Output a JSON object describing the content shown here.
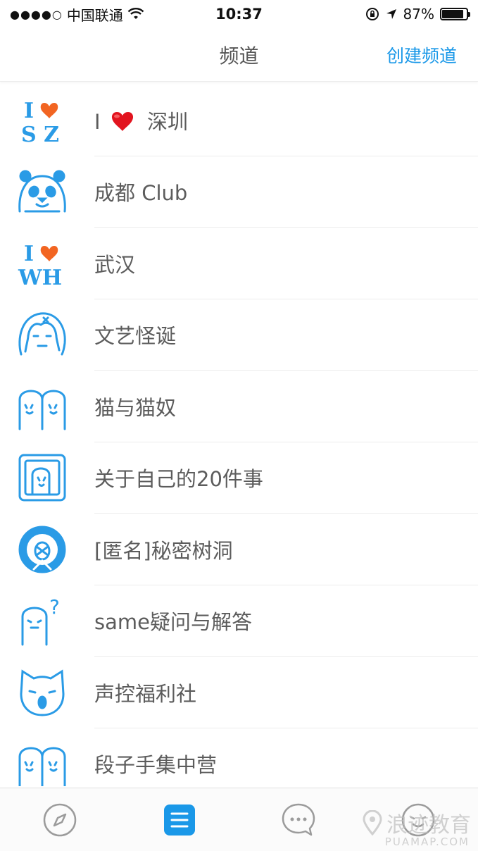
{
  "status_bar": {
    "signal": "●●●●○",
    "carrier": "中国联通",
    "time": "10:37",
    "battery_percent": "87%",
    "battery_level": 0.87
  },
  "nav": {
    "title": "频道",
    "create_label": "创建频道"
  },
  "channels": [
    {
      "label_prefix": "I",
      "label": "深圳"
    },
    {
      "label": "成都  Club"
    },
    {
      "label": "武汉"
    },
    {
      "label": "文艺怪诞"
    },
    {
      "label": "猫与猫奴"
    },
    {
      "label": "关于自己的20件事"
    },
    {
      "label": "[匿名]秘密树洞"
    },
    {
      "label": "same疑问与解答"
    },
    {
      "label": "声控福利社"
    },
    {
      "label": "段子手集中营"
    }
  ],
  "icon_text": {
    "sz_top": "I",
    "sz_bottom": "S Z",
    "wh_top": "I",
    "wh_bottom": "WH",
    "question_mark": "?"
  },
  "tabs": [
    {
      "name": "discover",
      "icon": "compass-icon"
    },
    {
      "name": "channels",
      "icon": "list-icon"
    },
    {
      "name": "messages",
      "icon": "chat-bubble-icon"
    },
    {
      "name": "profile",
      "icon": "smiley-face-icon"
    }
  ],
  "watermark": {
    "text": "浪迹教育",
    "sub": "PUAMAP.COM"
  },
  "colors": {
    "accent": "#1a98e8",
    "icon_blue": "#2a9be6",
    "heart": "#f26522",
    "text": "#5c5c5c"
  }
}
